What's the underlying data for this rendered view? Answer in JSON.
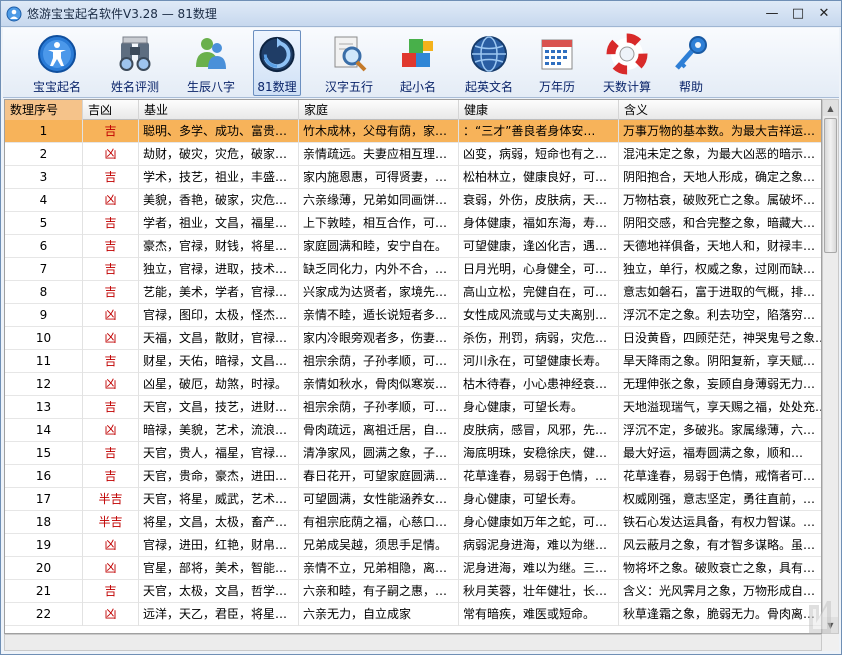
{
  "window": {
    "title": "悠游宝宝起名软件V3.28  —  81数理",
    "minimize_glyph": "—",
    "maximize_glyph": "□",
    "close_glyph": "✕"
  },
  "toolbar": {
    "items": [
      {
        "label": "宝宝起名",
        "icon": "accessibility-icon"
      },
      {
        "label": "姓名评测",
        "icon": "binoculars-icon"
      },
      {
        "label": "生辰八字",
        "icon": "messenger-icon"
      },
      {
        "label": "81数理",
        "icon": "refresh-icon",
        "active": true
      },
      {
        "label": "汉字五行",
        "icon": "magnifier-doc-icon"
      },
      {
        "label": "起小名",
        "icon": "cubes-icon"
      },
      {
        "label": "起英文名",
        "icon": "globe-icon"
      },
      {
        "label": "万年历",
        "icon": "calendar-icon"
      },
      {
        "label": "天数计算",
        "icon": "lifebuoy-icon"
      },
      {
        "label": "帮助",
        "icon": "key-icon"
      }
    ]
  },
  "table": {
    "columns": [
      "数理序号",
      "吉凶",
      "基业",
      "家庭",
      "健康",
      "含义"
    ],
    "rows": [
      [
        "1",
        "吉",
        "聪明、多学、成功、富贵…",
        "竹木成林，父母有荫，家…",
        "：“三才”善良者身体安…",
        "万事万物的基本数。为最大吉祥运…"
      ],
      [
        "2",
        "凶",
        "劫财，破灾，灾危，破家…",
        "亲情疏远。夫妻应相互理…",
        "凶变，病弱，短命也有之…",
        "混沌未定之象，为最大凶恶的暗示…"
      ],
      [
        "3",
        "吉",
        "学术，技艺，祖业，丰盛…",
        "家内施恩惠，可得贤妻，…",
        "松柏林立，健康良好，可…",
        "阴阳抱合，天地人形成，确定之象…"
      ],
      [
        "4",
        "凶",
        "美貌，香艳，破家，灾危…",
        "六亲缘薄，兄弟如同画饼…",
        "衰弱，外伤，皮肤病，天…",
        "万物枯衰，破败死亡之象。属破坏…"
      ],
      [
        "5",
        "吉",
        "学者，祖业，文昌，福星…",
        "上下敦睦，相互合作，可…",
        "身体健康，福如东海，寿…",
        "阴阳交感，和合完整之象，暗藏大…"
      ],
      [
        "6",
        "吉",
        "豪杰，官禄，财钱，将星…",
        "家庭圆满和睦，安宁自在。",
        "可望健康，逢凶化吉，遇…",
        "天德地祥俱备，天地人和，财禄丰…"
      ],
      [
        "7",
        "吉",
        "独立，官禄，进取，技术…",
        "缺乏同化力，内外不合，…",
        "日月光明，心身健全，可…",
        "独立，单行，权威之象，过刚而缺…"
      ],
      [
        "8",
        "吉",
        "艺能，美术，学者，官禄…",
        "兴家成为达贤者，家境先…",
        "高山立松，完健自在，可…",
        "意志如磐石，富于进取的气概，排…"
      ],
      [
        "9",
        "凶",
        "官禄，图印，太极，怪杰…",
        "亲情不睦，遁长说短者多…",
        "女性成风流或与丈夫离别…",
        "浮沉不定之象。利去功空，陷落穷…"
      ],
      [
        "10",
        "凶",
        "天福，文昌，散财，官禄…",
        "家内冷眼旁观者多，伤妻…",
        "杀伤，刑罚，病弱，灾危…",
        "日没黄昏，四顾茫茫，神哭鬼号之象…"
      ],
      [
        "11",
        "吉",
        "财星，天佑，暗禄，文昌…",
        "祖宗余荫，子孙孝顺，可…",
        "河川永在，可望健康长寿。",
        "旱天降雨之象。阴阳复新，享天赋…"
      ],
      [
        "12",
        "凶",
        "凶星，破厄，劫煞，时禄。",
        "亲情如秋水，骨肉似寒炭…",
        "枯木待春，小心患神经衰…",
        "无理伸张之象，妄顾自身薄弱无力…"
      ],
      [
        "13",
        "吉",
        "天官，文昌，技艺，进财…",
        "祖宗余荫，子孙孝顺，可…",
        "身心健康，可望长寿。",
        "天地溢现瑞气，享天赐之福，处处充…"
      ],
      [
        "14",
        "凶",
        "暗禄，美貌，艺术，流浪…",
        "骨肉疏远，离祖迁居，自…",
        "皮肤病，感冒，风邪，先…",
        "浮沉不定，多破兆。家属缘薄，六…"
      ],
      [
        "15",
        "吉",
        "天官，贵人，福星，官禄…",
        "清净家风，圆满之象，子…",
        "海底明珠，安稳徐庆，健…",
        "最大好运，福寿圆满之象，顺和…"
      ],
      [
        "16",
        "吉",
        "天官，贵命，豪杰，进田…",
        "春日花开，可望家庭圆满…",
        "花草逢春，易弱于色情，…",
        "花草逢春，易弱于色情，戒惰者可…"
      ],
      [
        "17",
        "半吉",
        "天官，将星，威武，艺术…",
        "可望圆满，女性能涵养女…",
        "身心健康，可望长寿。",
        "权威刚强，意志坚定，勇往直前，…"
      ],
      [
        "18",
        "半吉",
        "将星，文昌，太极，畜产…",
        "有祖宗庇荫之福，心慈口…",
        "身心健康如万年之蛇，可…",
        "铁石心发达运具备，有权力智谋。…"
      ],
      [
        "19",
        "凶",
        "官禄，进田，红艳，财帛…",
        "兄弟成吴越，须思手足情。",
        "病弱泥身进海，难以为继…",
        "风云蔽月之象，有才智多谋略。虽…"
      ],
      [
        "20",
        "凶",
        "官星，部将，美术，智能…",
        "亲情不立，兄弟相隐，离…",
        "泥身进海，难以为继。三…",
        "物将坏之象。破败衰亡之象，具有…"
      ],
      [
        "21",
        "吉",
        "天官，太极，文昌，哲学…",
        "六亲和睦，有子嗣之惠，…",
        "秋月芙蓉，壮年健壮，长…",
        "含义：光风霁月之象，万物形成自…"
      ],
      [
        "22",
        "凶",
        "远洋，天乙，君臣，将星…",
        "六亲无力，自立成家",
        "常有暗疾，难医或短命。",
        "秋草逢霜之象，脆弱无力。骨肉离…"
      ]
    ]
  },
  "scrollbar": {
    "up_glyph": "▲",
    "down_glyph": "▼"
  }
}
